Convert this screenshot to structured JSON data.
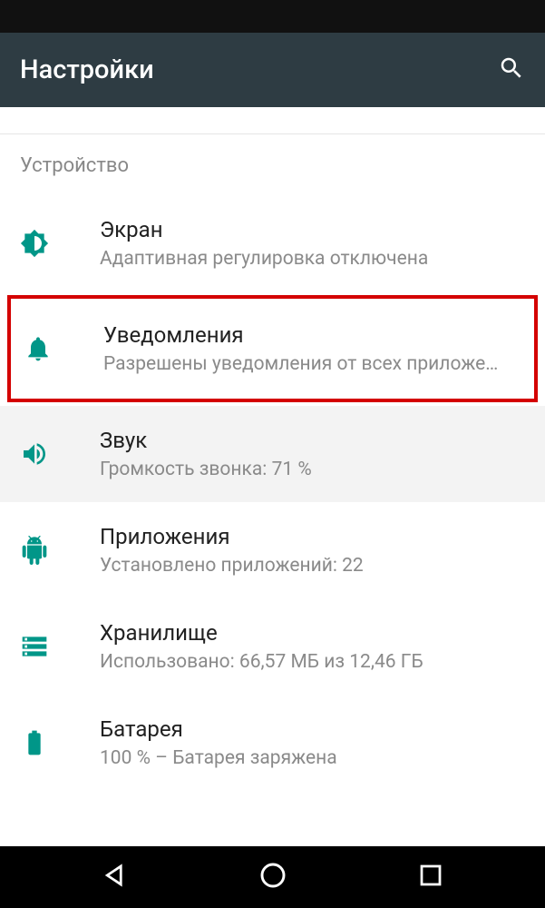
{
  "appBar": {
    "title": "Настройки"
  },
  "section": {
    "header": "Устройство"
  },
  "items": {
    "display": {
      "title": "Экран",
      "subtitle": "Адаптивная регулировка отключена"
    },
    "notifications": {
      "title": "Уведомления",
      "subtitle": "Разрешены уведомления от всех приложе…"
    },
    "sound": {
      "title": "Звук",
      "subtitle": "Громкость звонка: 71 %"
    },
    "apps": {
      "title": "Приложения",
      "subtitle": "Установлено приложений: 22"
    },
    "storage": {
      "title": "Хранилище",
      "subtitle": "Использовано: 66,57 МБ из 12,46 ГБ"
    },
    "battery": {
      "title": "Батарея",
      "subtitle": "100 % – Батарея заряжена"
    }
  },
  "colors": {
    "accent": "#009688",
    "appbar": "#2e3c43",
    "highlight": "#d40000"
  }
}
